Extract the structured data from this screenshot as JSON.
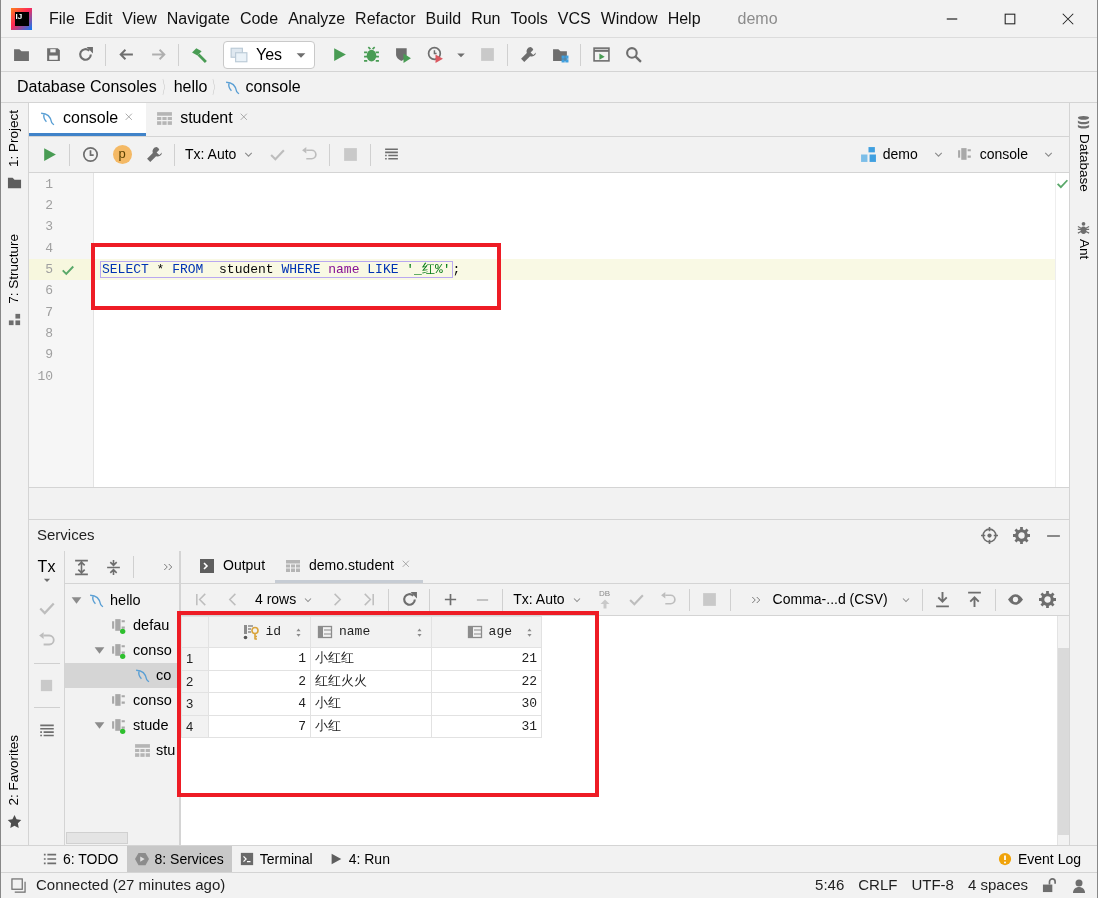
{
  "window": {
    "logo_text": "IJ",
    "title": "demo"
  },
  "menu": [
    "File",
    "Edit",
    "View",
    "Navigate",
    "Code",
    "Analyze",
    "Refactor",
    "Build",
    "Run",
    "Tools",
    "VCS",
    "Window",
    "Help"
  ],
  "toolbar": {
    "run_config": "Yes"
  },
  "breadcrumb": [
    "Database Consoles",
    "hello",
    "console"
  ],
  "left_stripe": [
    {
      "label": "1: Project",
      "kind": "project"
    },
    {
      "label": "7: Structure",
      "kind": "structure"
    },
    {
      "label": "2: Favorites",
      "kind": "favorites"
    }
  ],
  "right_stripe": [
    {
      "label": "Database",
      "kind": "database"
    },
    {
      "label": "Ant",
      "kind": "ant"
    }
  ],
  "editor_tabs": [
    {
      "label": "console",
      "kind": "console",
      "selected": true
    },
    {
      "label": "student",
      "kind": "table",
      "selected": false
    }
  ],
  "editor_toolbar": {
    "badge": "p",
    "tx_mode": "Tx: Auto",
    "data_source": "demo",
    "session": "console"
  },
  "editor": {
    "highlighted": true,
    "lines": [
      {
        "number": "1"
      },
      {
        "number": "2"
      },
      {
        "number": "3"
      },
      {
        "number": "4"
      },
      {
        "number": "5",
        "current": true,
        "passed": true,
        "statement": [
          {
            "text": "SELECT",
            "kind": "keyword"
          },
          {
            "text": " * ",
            "kind": "plain"
          },
          {
            "text": "FROM",
            "kind": "keyword"
          },
          {
            "text": "  student ",
            "kind": "plain"
          },
          {
            "text": "WHERE ",
            "kind": "keyword"
          },
          {
            "text": "name",
            "kind": "column"
          },
          {
            "text": " LIKE ",
            "kind": "keyword"
          },
          {
            "text": "'_红%'",
            "kind": "string"
          }
        ],
        "suffix": ";"
      },
      {
        "number": "6"
      },
      {
        "number": "7"
      },
      {
        "number": "8"
      },
      {
        "number": "9"
      },
      {
        "number": "10"
      }
    ]
  },
  "services": {
    "title": "Services",
    "tx_label": "Tx",
    "tree": [
      {
        "label": "hello",
        "kind": "console",
        "expanded": true,
        "selected": false,
        "children": [
          {
            "label": "defau",
            "kind": "session",
            "connected": true,
            "selected": false
          },
          {
            "label": "conso",
            "kind": "session",
            "connected": true,
            "expanded": true,
            "selected": false,
            "children": [
              {
                "label": "co",
                "kind": "console",
                "selected": true
              }
            ]
          },
          {
            "label": "conso",
            "kind": "session",
            "connected": false,
            "selected": false
          },
          {
            "label": "stude",
            "kind": "session",
            "connected": true,
            "expanded": true,
            "selected": false,
            "children": [
              {
                "label": "stu",
                "kind": "table",
                "selected": false
              }
            ]
          }
        ]
      }
    ],
    "tabs": [
      {
        "label": "Output",
        "kind": "output",
        "selected": false
      },
      {
        "label": "demo.student",
        "kind": "table",
        "selected": true
      }
    ],
    "grid_toolbar": {
      "rows": "4 rows",
      "tx_mode": "Tx: Auto",
      "db_label": "DB",
      "format": "Comma-...d (CSV)"
    },
    "result": {
      "highlighted": true,
      "columns": [
        {
          "label": "id",
          "key": true,
          "numeric": true
        },
        {
          "label": "name",
          "key": false,
          "numeric": false
        },
        {
          "label": "age",
          "key": false,
          "numeric": true
        }
      ],
      "rows": [
        {
          "number": "1",
          "cells": [
            "1",
            "小红红",
            "21"
          ]
        },
        {
          "number": "2",
          "cells": [
            "2",
            "红红火火",
            "22"
          ]
        },
        {
          "number": "3",
          "cells": [
            "4",
            "小红",
            "30"
          ]
        },
        {
          "number": "4",
          "cells": [
            "7",
            "小红",
            "31"
          ]
        }
      ]
    }
  },
  "tool_tabs": [
    {
      "label": "6: TODO",
      "kind": "todo",
      "selected": false
    },
    {
      "label": "8: Services",
      "kind": "services",
      "selected": true
    },
    {
      "label": "Terminal",
      "kind": "terminal",
      "selected": false
    },
    {
      "label": "4: Run",
      "kind": "run",
      "selected": false
    },
    {
      "label": "Event Log",
      "kind": "event_log",
      "selected": false
    }
  ],
  "status_bar": {
    "message": "Connected (27 minutes ago)",
    "position": "5:46",
    "line_separator": "CRLF",
    "encoding": "UTF-8",
    "indent": "4 spaces"
  }
}
